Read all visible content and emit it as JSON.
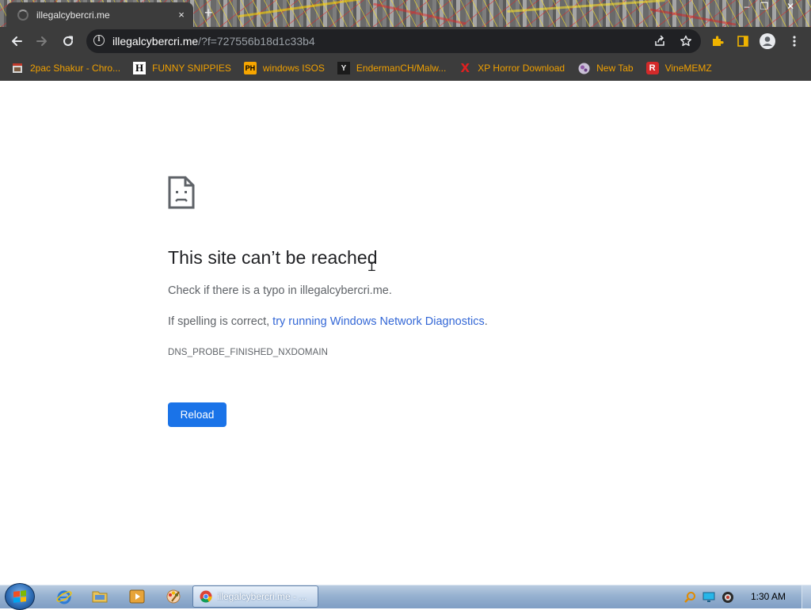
{
  "browser": {
    "tab": {
      "title": "illegalcybercri.me",
      "close_glyph": "×"
    },
    "newtab_glyph": "+",
    "window_controls": {
      "minimize": "–",
      "maximize": "❐",
      "close": "✕"
    },
    "address": {
      "host": "illegalcybercri.me",
      "path": "/?f=727556b18d1c33b4"
    },
    "bookmarks": [
      {
        "label": "2pac Shakur - Chro...",
        "icon": "photo-bookmark-icon"
      },
      {
        "label": "FUNNY SNIPPIES",
        "icon": "h-letter-icon",
        "glyph": "H"
      },
      {
        "label": "windows ISOS",
        "icon": "ph-logo-icon",
        "glyph": "PH"
      },
      {
        "label": "EndermanCH/Malw...",
        "icon": "youtube-channel-icon",
        "glyph": "Y"
      },
      {
        "label": "XP Horror Download",
        "icon": "x-letter-icon",
        "glyph": "X"
      },
      {
        "label": "New Tab",
        "icon": "globe-icon"
      },
      {
        "label": "VineMEMZ",
        "icon": "r-logo-icon",
        "glyph": "R"
      }
    ]
  },
  "error_page": {
    "title": "This site can’t be reached",
    "typo_line": "Check if there is a typo in illegalcybercri.me.",
    "spelling_prefix": "If spelling is correct, ",
    "diagnostics_link": "try running Windows Network Diagnostics",
    "spelling_suffix": ".",
    "error_code": "DNS_PROBE_FINISHED_NXDOMAIN",
    "reload_label": "Reload"
  },
  "taskbar": {
    "active_window": "illegalcybercri.me - ...",
    "clock": "1:30 AM"
  },
  "colors": {
    "accent": "#1a73e8",
    "link": "#3367d6",
    "bookmark_text": "#f0a000",
    "toolbar": "#3c3c3c",
    "omnibox": "#202124"
  }
}
